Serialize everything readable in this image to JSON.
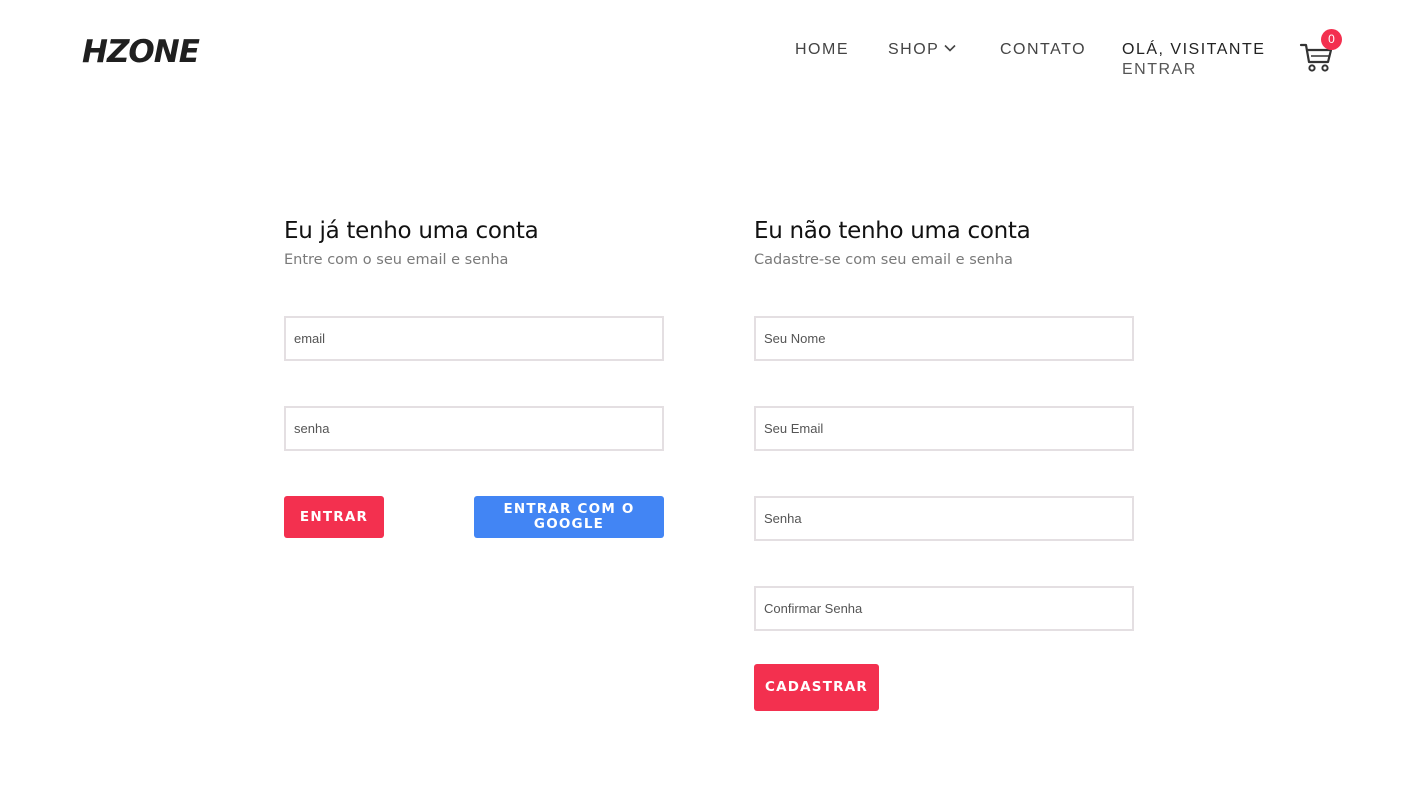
{
  "header": {
    "logo": "HZONE",
    "nav": {
      "home": "HOME",
      "shop": "SHOP",
      "contato": "CONTATO"
    },
    "greeting": "OLÁ, VISITANTE",
    "login_link": "ENTRAR",
    "cart_count": "0"
  },
  "login": {
    "title": "Eu já tenho uma conta",
    "subtitle": "Entre com o seu email e senha",
    "email_placeholder": "email",
    "password_placeholder": "senha",
    "submit_label": "ENTRAR",
    "google_label": "ENTRAR COM O GOOGLE"
  },
  "register": {
    "title": "Eu não tenho uma conta",
    "subtitle": "Cadastre-se com seu email e senha",
    "name_placeholder": "Seu Nome",
    "email_placeholder": "Seu Email",
    "password_placeholder": "Senha",
    "confirm_placeholder": "Confirmar Senha",
    "submit_label": "CADASTRAR"
  },
  "colors": {
    "accent": "#f3304f",
    "google": "#4285f4",
    "input_border": "#e4dfe2"
  },
  "icons": {
    "cart": "cart-icon",
    "shop_dropdown": "chevron-down-icon"
  }
}
